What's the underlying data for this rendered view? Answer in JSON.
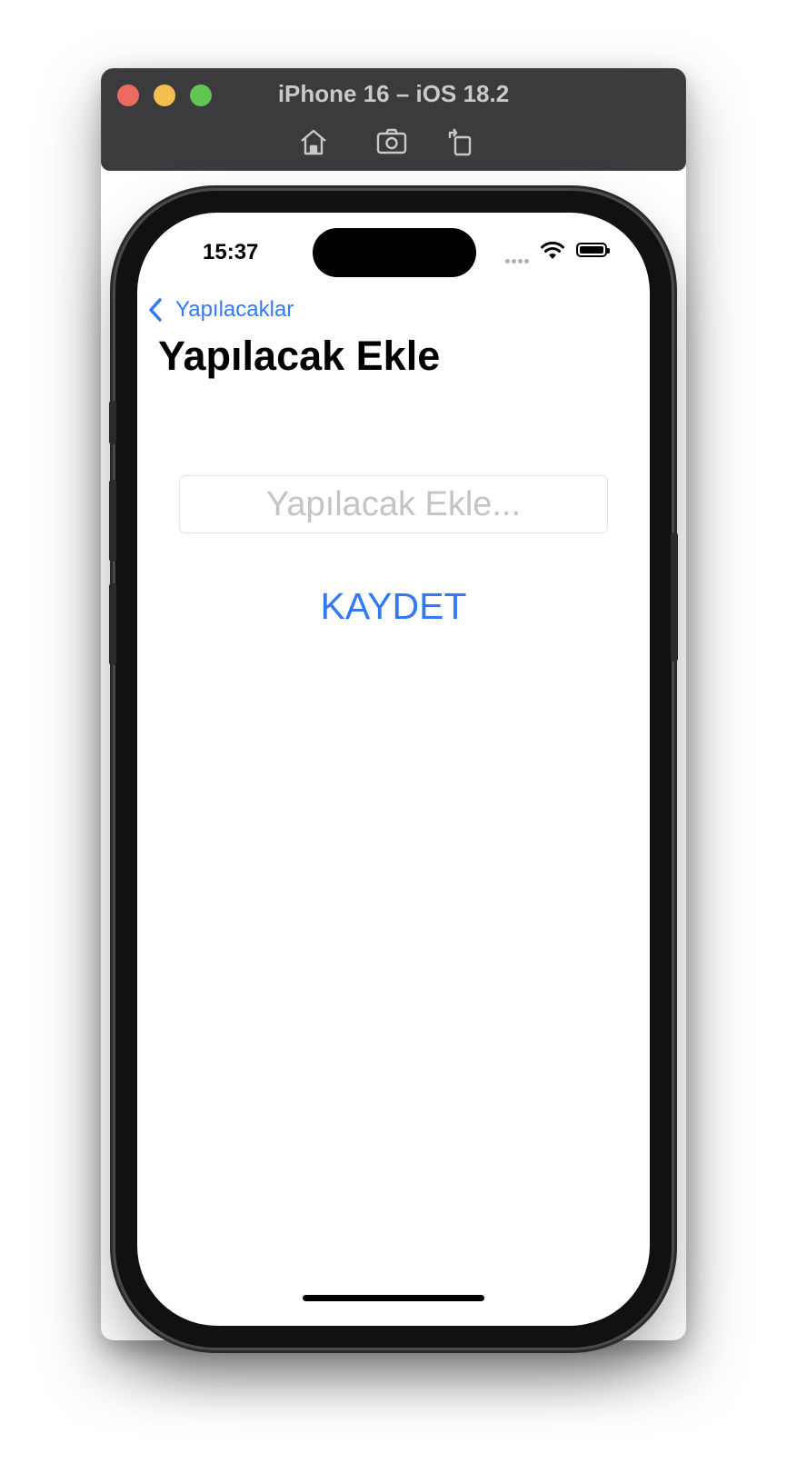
{
  "window": {
    "title": "iPhone 16 – iOS 18.2",
    "toolbar_icons": [
      "home-icon",
      "screenshot-camera-icon",
      "rotate-icon"
    ]
  },
  "status_bar": {
    "time": "15:37",
    "icons": [
      "cellular-signal-icon",
      "wifi-icon",
      "battery-icon"
    ]
  },
  "nav": {
    "back_label": "Yapılacaklar",
    "title": "Yapılacak Ekle"
  },
  "form": {
    "input_placeholder": "Yapılacak Ekle...",
    "input_value": "",
    "save_label": "KAYDET"
  },
  "colors": {
    "accent": "#3478f6",
    "titlebar": "#3b3b3d",
    "placeholder": "#c4c4c6"
  }
}
